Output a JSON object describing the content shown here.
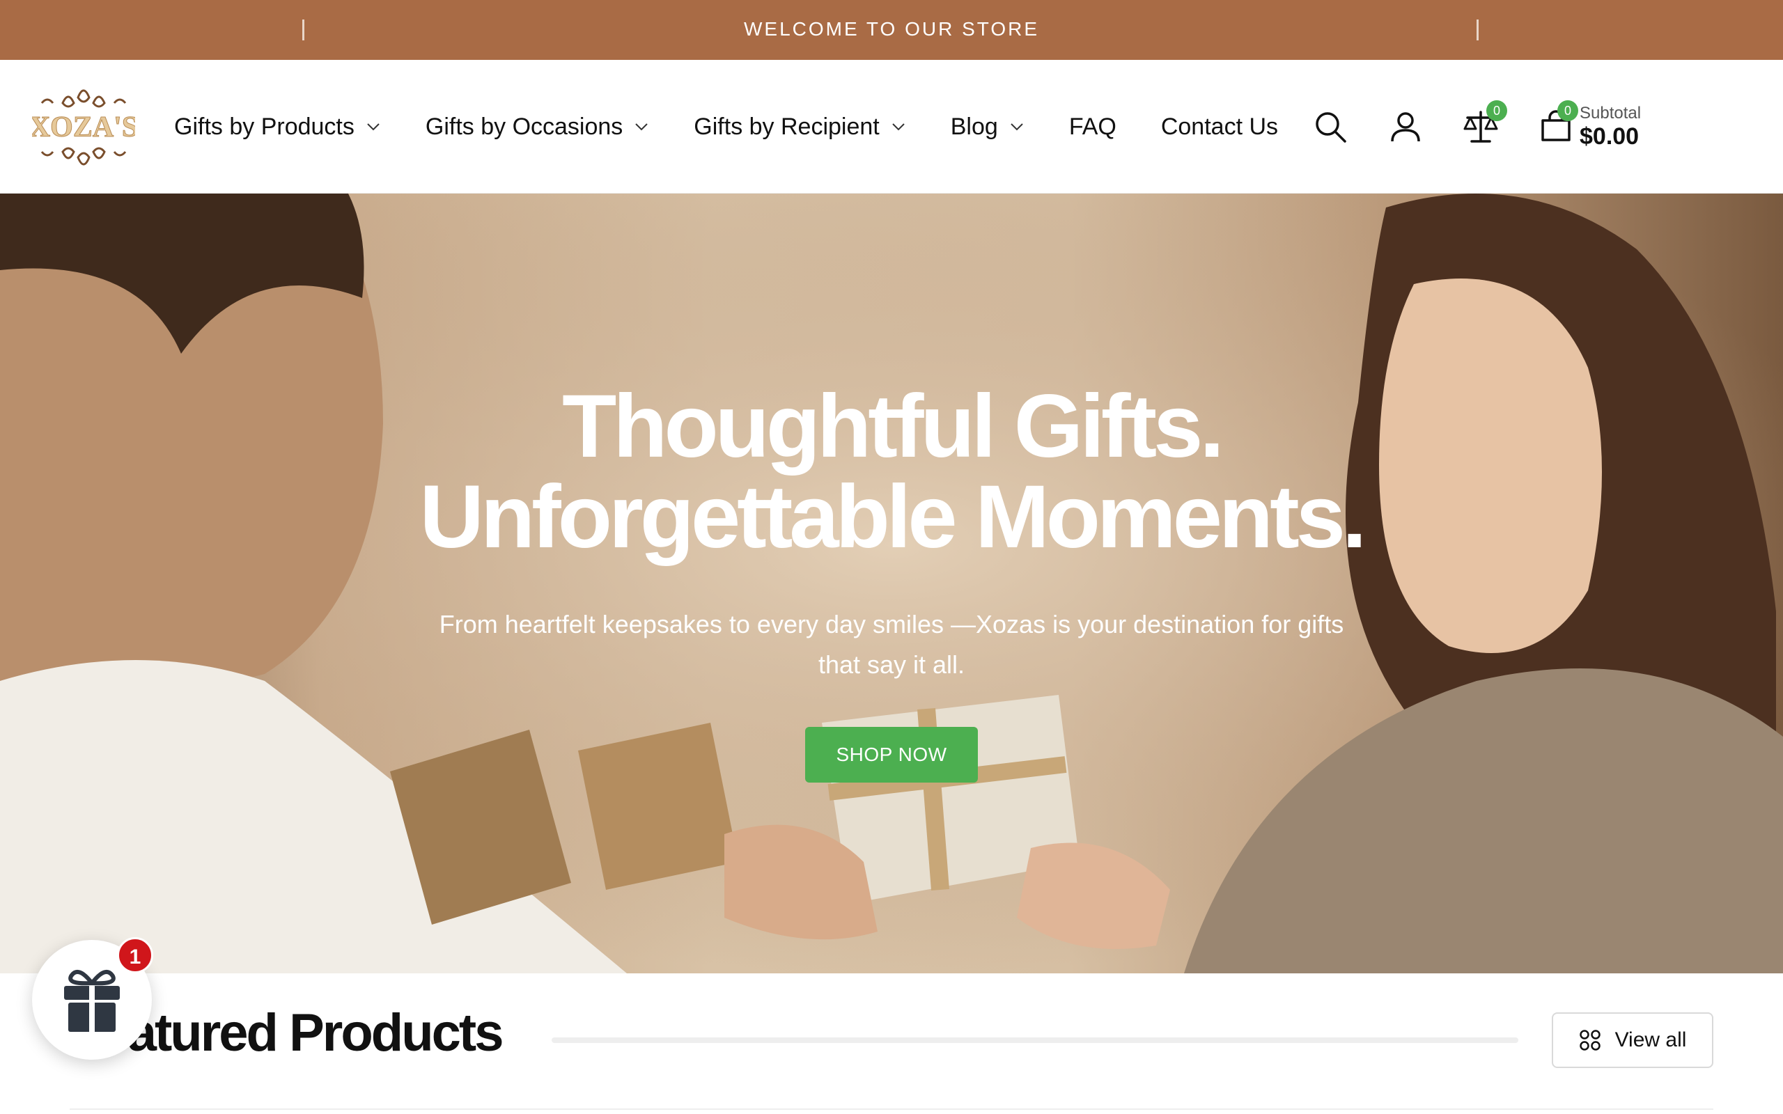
{
  "announcement": {
    "text": "WELCOME TO OUR STORE"
  },
  "header": {
    "logo_text": "XOZA'S",
    "nav": [
      {
        "label": "Gifts by Products",
        "dropdown": true
      },
      {
        "label": "Gifts by Occasions",
        "dropdown": true
      },
      {
        "label": "Gifts by Recipient",
        "dropdown": true
      },
      {
        "label": "Blog",
        "dropdown": true
      },
      {
        "label": "FAQ",
        "dropdown": false
      },
      {
        "label": "Contact Us",
        "dropdown": false
      }
    ],
    "icons": [
      "search-icon",
      "account-icon",
      "compare-icon",
      "cart-icon"
    ],
    "compare_count": "0",
    "cart_count": "0",
    "subtotal_label": "Subtotal",
    "subtotal_value": "$0.00"
  },
  "hero": {
    "title_line1": "Thoughtful Gifts.",
    "title_line2": "Unforgettable Moments.",
    "subtitle": "From heartfelt keepsakes to every day smiles —Xozas is your destination for gifts that say it all.",
    "cta": "SHOP NOW"
  },
  "featured": {
    "title": "Featured Products",
    "view_all": "View all"
  },
  "gift_widget": {
    "badge": "1"
  },
  "colors": {
    "announcement_bg": "#a96b45",
    "accent_green": "#4caf50",
    "badge_red": "#d0161b",
    "logo_gold": "#c9a46a"
  }
}
